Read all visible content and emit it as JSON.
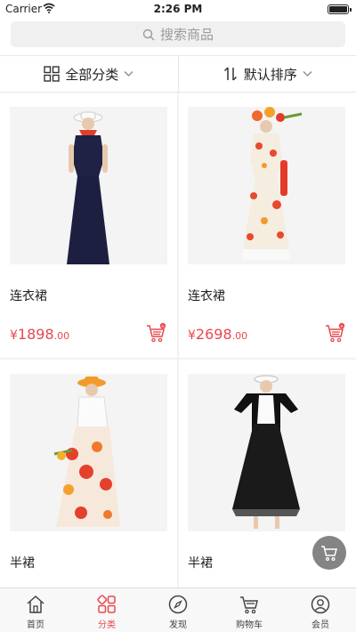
{
  "status": {
    "carrier": "Carrier",
    "time": "2:26 PM"
  },
  "search": {
    "placeholder": "搜索商品",
    "icon": "search-icon"
  },
  "filters": [
    {
      "label": "全部分类",
      "icon": "grid-icon"
    },
    {
      "label": "默认排序",
      "icon": "sort-icon"
    }
  ],
  "products": [
    {
      "name": "连衣裙",
      "price_symbol": "¥",
      "price_int": "1898",
      "price_dec": ".00"
    },
    {
      "name": "连衣裙",
      "price_symbol": "¥",
      "price_int": "2698",
      "price_dec": ".00"
    },
    {
      "name": "半裙"
    },
    {
      "name": "半裙"
    }
  ],
  "tabs": [
    {
      "label": "首页",
      "icon": "home-icon"
    },
    {
      "label": "分类",
      "icon": "category-icon"
    },
    {
      "label": "发现",
      "icon": "compass-icon"
    },
    {
      "label": "购物车",
      "icon": "cart-icon"
    },
    {
      "label": "会员",
      "icon": "user-icon"
    }
  ],
  "active_tab": "分类",
  "colors": {
    "accent": "#e8474c",
    "text": "#222222",
    "muted": "#9a9a9a"
  }
}
